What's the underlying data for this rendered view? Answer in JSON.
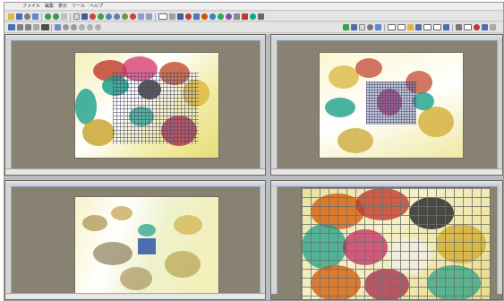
{
  "menubar": {
    "items": [
      "ファイル",
      "編集",
      "表示",
      "ツール",
      "ヘルプ"
    ]
  },
  "panes": {
    "top_left": {
      "title": "",
      "ruler_ticks": [
        "",
        "",
        "",
        "",
        ""
      ]
    },
    "top_right": {
      "title": "",
      "ruler_ticks": [
        "",
        "",
        "",
        "",
        ""
      ]
    },
    "bottom_left": {
      "title": "",
      "ruler_ticks": [
        "",
        "",
        "",
        "",
        ""
      ]
    },
    "bottom_right": {
      "title": ""
    }
  },
  "colors": {
    "pane_background": "#888273",
    "title_bar": "#c6ccd6",
    "grid_overlay": "#46466e",
    "selection_blue": "#3b5fa8"
  },
  "toolbar_icons": [
    "open-icon",
    "save-icon",
    "print-icon",
    "undo-icon",
    "redo-icon",
    "zoom-in-icon",
    "zoom-out-icon",
    "grid-icon",
    "pointer-icon",
    "layer-icon"
  ]
}
